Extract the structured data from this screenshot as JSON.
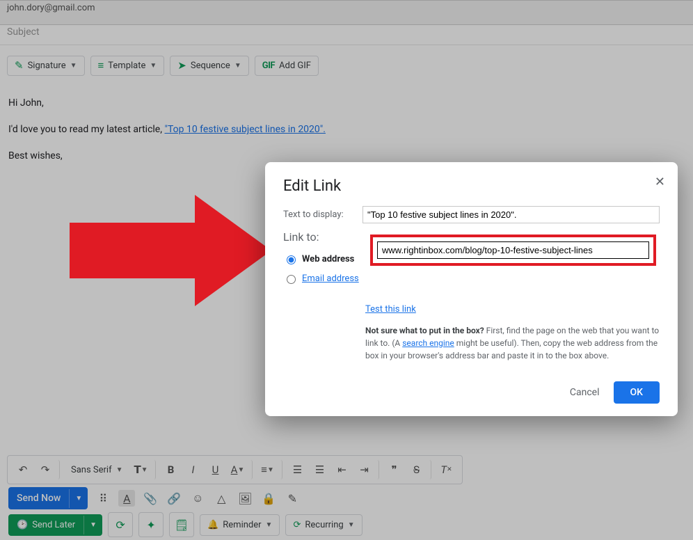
{
  "header": {
    "to": "john.dory@gmail.com",
    "subject_placeholder": "Subject"
  },
  "toolbar": {
    "signature": "Signature",
    "template": "Template",
    "sequence": "Sequence",
    "add_gif": "Add GIF",
    "gif_prefix": "GIF"
  },
  "body": {
    "line1": "Hi John,",
    "line2_pre": "I'd love you to read my latest article, ",
    "line2_link": "\"Top 10 festive subject lines in 2020\".",
    "line3": "Best wishes,"
  },
  "formatbar": {
    "font": "Sans Serif"
  },
  "send": {
    "now": "Send Now",
    "later": "Send Later",
    "reminder": "Reminder",
    "recurring": "Recurring"
  },
  "modal": {
    "title": "Edit Link",
    "text_to_display_label": "Text to display:",
    "text_to_display_value": "\"Top 10 festive subject lines in 2020\".",
    "link_to_label": "Link to:",
    "radio_web": "Web address",
    "radio_email": "Email address",
    "url_value": "www.rightinbox.com/blog/top-10-festive-subject-lines",
    "test_link": "Test this link",
    "help_bold": "Not sure what to put in the box?",
    "help_rest_1": " First, find the page on the web that you want to link to. (A ",
    "help_search_engine": "search engine",
    "help_rest_2": " might be useful). Then, copy the web address from the box in your browser's address bar and paste it in to the box above.",
    "cancel": "Cancel",
    "ok": "OK"
  }
}
